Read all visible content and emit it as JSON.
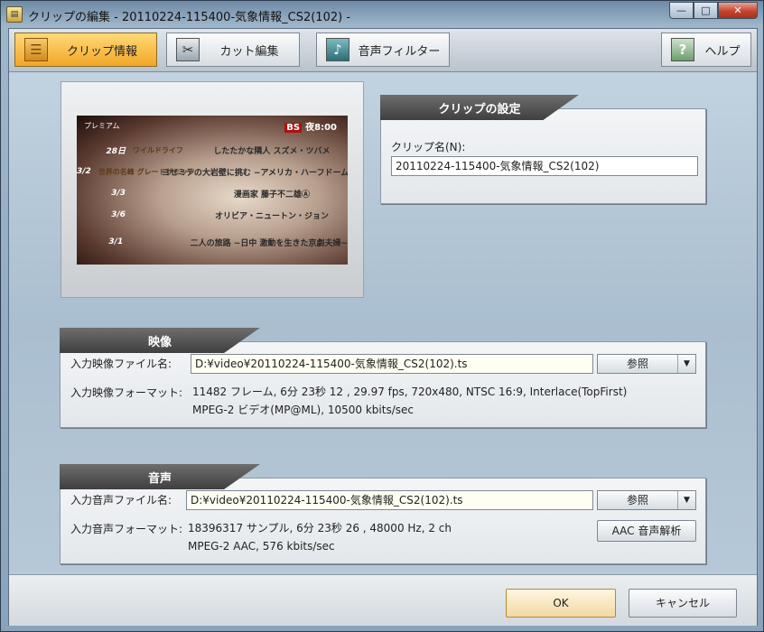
{
  "window": {
    "title": "クリップの編集 - 20110224-115400-気象情報_CS2(102) -",
    "minimize": "—",
    "maximize": "□",
    "close": "✕"
  },
  "tabs": [
    {
      "label": "クリップ情報",
      "icon": "clip-info-icon"
    },
    {
      "label": "カット編集",
      "icon": "scissors-icon"
    },
    {
      "label": "音声フィルター",
      "icon": "music-note-icon"
    }
  ],
  "help": {
    "label": "ヘルプ",
    "icon": "question-icon"
  },
  "preview": {
    "brand": "プレミアム",
    "header_badge": "BS",
    "header_time": "夜8:00",
    "rows": [
      {
        "date": "28日",
        "logo": "ワイルドライフ",
        "title": "したたかな隣人 スズメ・ツバメ"
      },
      {
        "date": "3/2",
        "logo": "世界の名峰 グレートサミッツ",
        "title": "ヨセミテの大岩壁に挑む ~アメリカ・ハーフドーム~"
      },
      {
        "date": "3/3",
        "logo": "",
        "title": "漫画家 藤子不二雄Ⓐ"
      },
      {
        "date": "3/6",
        "logo": "",
        "title": "オリビア・ニュートン・ジョン"
      },
      {
        "date": "3/1",
        "logo": "",
        "title": "二人の旅路 ~日中 激動を生きた京劇夫婦~"
      }
    ]
  },
  "clip_settings": {
    "header": "クリップの設定",
    "name_label": "クリップ名(N):",
    "name_value": "20110224-115400-気象情報_CS2(102)"
  },
  "video": {
    "header": "映像",
    "file_label": "入力映像ファイル名:",
    "file_value": "D:¥video¥20110224-115400-気象情報_CS2(102).ts",
    "browse": "参照",
    "format_label": "入力映像フォーマット:",
    "format_line1": "11482 フレーム, 6分 23秒 12 , 29.97 fps, 720x480, NTSC 16:9, Interlace(TopFirst)",
    "format_line2": "MPEG-2 ビデオ(MP@ML), 10500 kbits/sec"
  },
  "audio": {
    "header": "音声",
    "file_label": "入力音声ファイル名:",
    "file_value": "D:¥video¥20110224-115400-気象情報_CS2(102).ts",
    "browse": "参照",
    "format_label": "入力音声フォーマット:",
    "format_line1": "18396317 サンプル, 6分 23秒 26 , 48000 Hz, 2 ch",
    "format_line2": "MPEG-2 AAC, 576 kbits/sec",
    "analyze": "AAC 音声解析"
  },
  "footer": {
    "ok": "OK",
    "cancel": "キャンセル"
  }
}
